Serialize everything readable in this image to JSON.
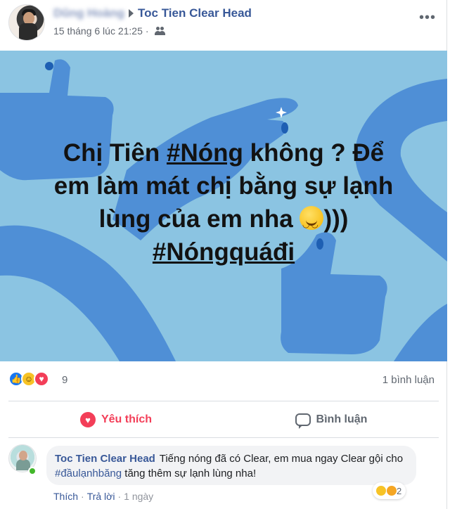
{
  "header": {
    "author": "Dũng Hoàng",
    "page_name": "Toc Tien Clear Head",
    "timestamp": "15 tháng 6 lúc 21:25",
    "separator": "·",
    "audience_icon": "friends-icon",
    "more_icon": "more-icon"
  },
  "image": {
    "line1_a": "Chị Tiên ",
    "line1_tag": "#Nóng",
    "line1_b": " không ? Để",
    "line2": "em làm mát chị bằng sự lạnh",
    "line3_a": "lùng của em nha ",
    "line3_b": ")))",
    "line4_tag": "#Nóngquáđi",
    "background_color": "#8bc4e2",
    "shape_color": "#4f8fd6"
  },
  "reactions": {
    "icons": [
      "like",
      "haha",
      "love"
    ],
    "count": "9",
    "comments": "1 bình luận"
  },
  "actions": {
    "like_label": "Yêu thích",
    "comment_label": "Bình luận"
  },
  "comment": {
    "author": "Toc Tien Clear Head",
    "text_a": " Tiếng nóng đã có Clear, em mua ngay Clear gội cho ",
    "hashtag": "#đầulạnhbăng",
    "text_b": " tăng thêm sự lạnh lùng nha!",
    "reaction_count": "2",
    "like_link": "Thích",
    "reply_link": "Trả lời",
    "dot": "·",
    "time": "1 ngày"
  },
  "colors": {
    "link": "#385898",
    "love": "#f33e58",
    "like": "#1877f2"
  }
}
